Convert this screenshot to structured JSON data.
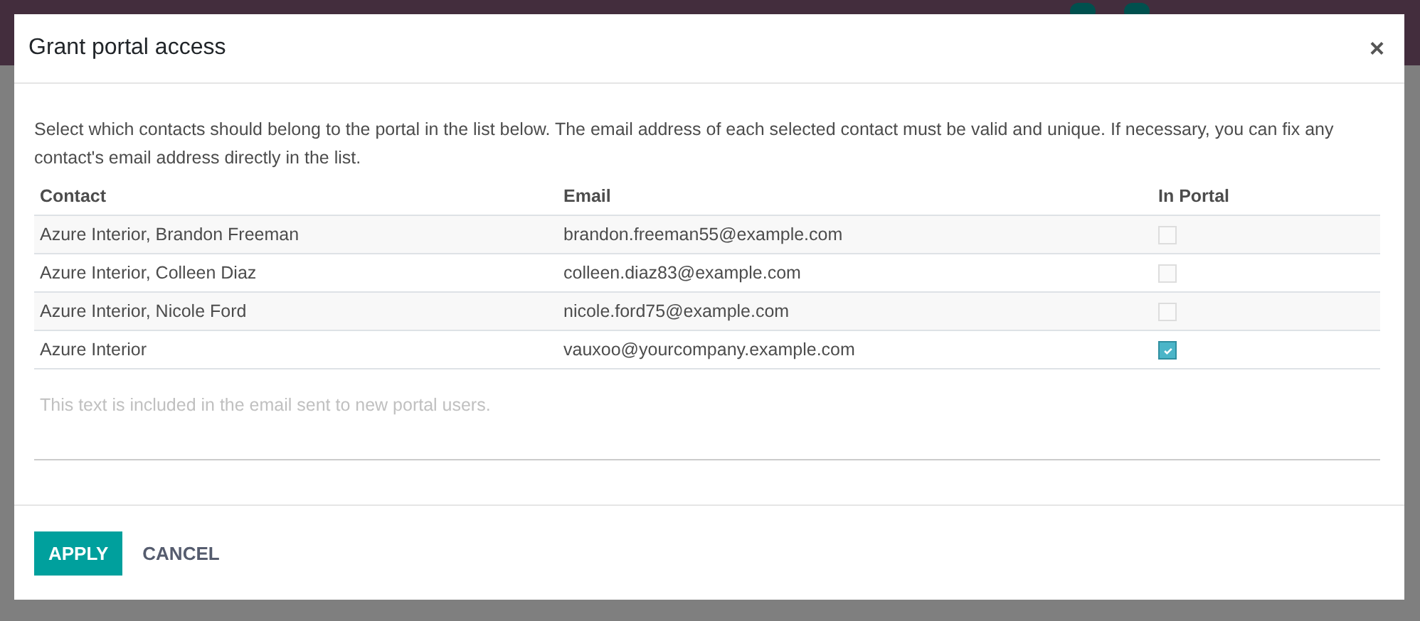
{
  "dialog": {
    "title": "Grant portal access",
    "close": "×",
    "intro": "Select which contacts should belong to the portal in the list below. The email address of each selected contact must be valid and unique. If necessary, you can fix any contact's email address directly in the list.",
    "table": {
      "columns": [
        "Contact",
        "Email",
        "In Portal"
      ],
      "rows": [
        {
          "contact": "Azure Interior, Brandon Freeman",
          "email": "brandon.freeman55@example.com",
          "checked": false
        },
        {
          "contact": "Azure Interior, Colleen Diaz",
          "email": "colleen.diaz83@example.com",
          "checked": false
        },
        {
          "contact": "Azure Interior, Nicole Ford",
          "email": "nicole.ford75@example.com",
          "checked": false
        },
        {
          "contact": "Azure Interior",
          "email": "vauxoo@yourcompany.example.com",
          "checked": true
        }
      ]
    },
    "message": {
      "placeholder": "This text is included in the email sent to new portal users."
    },
    "buttons": [
      {
        "label": "APPLY",
        "kind": "primary"
      },
      {
        "label": "CANCEL",
        "kind": "secondary"
      }
    ]
  }
}
